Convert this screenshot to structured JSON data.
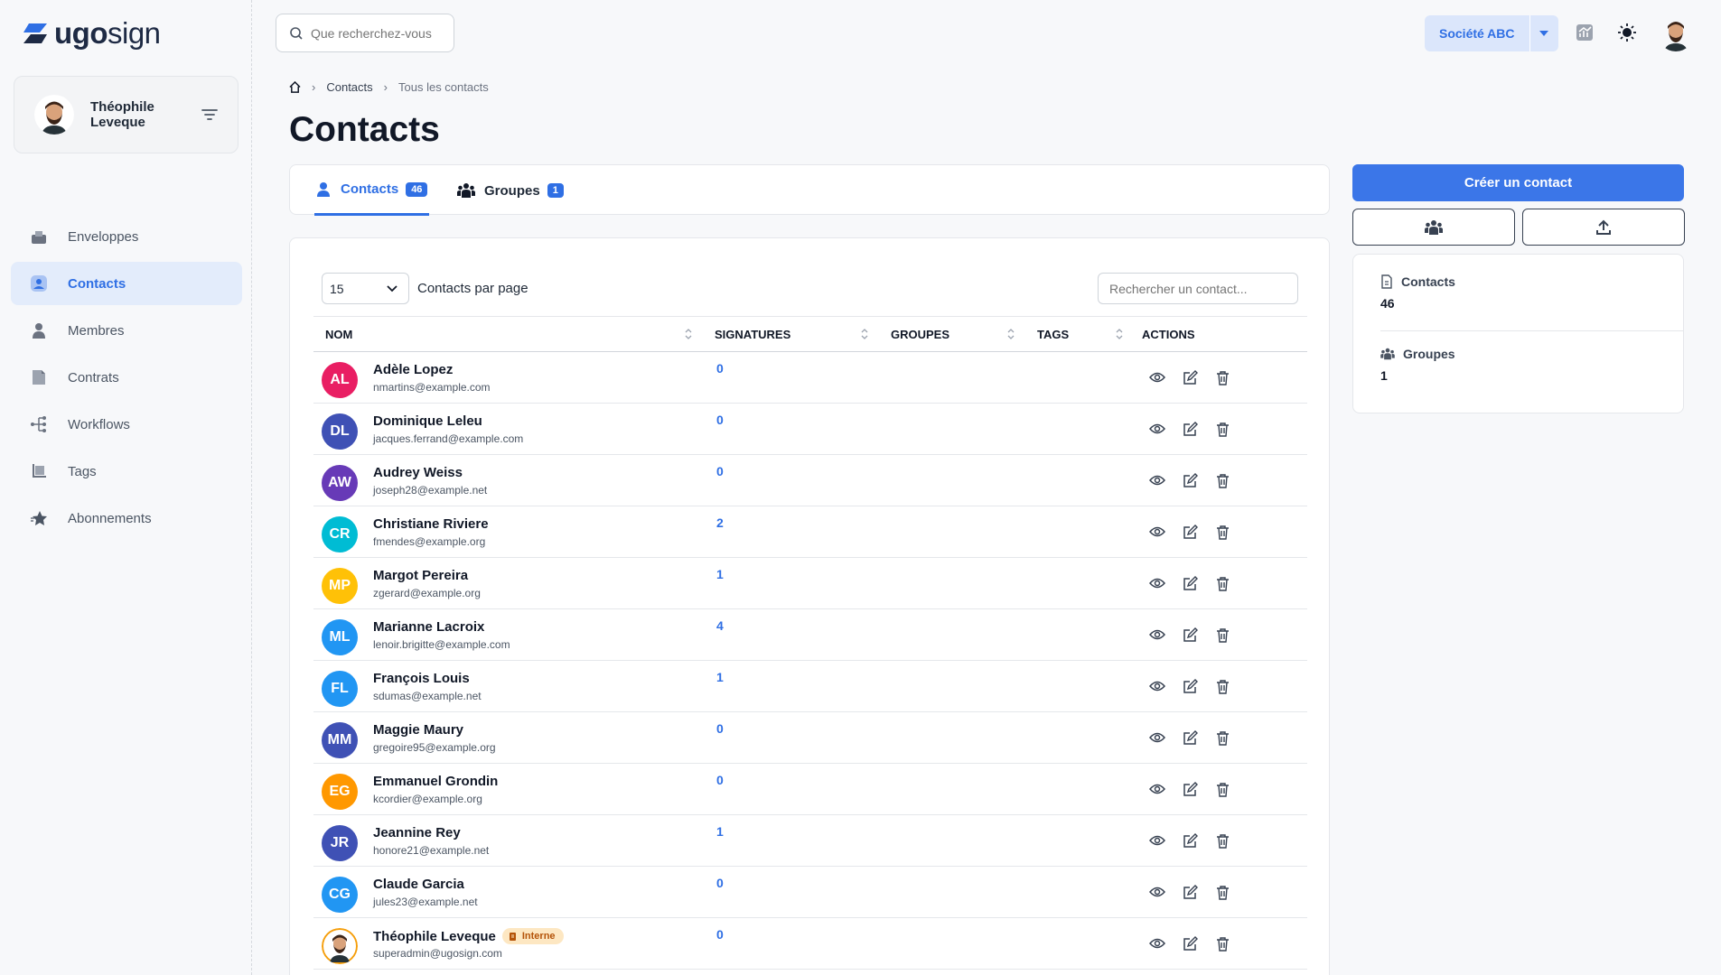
{
  "brand": {
    "name_bold": "ugo",
    "name_light": "sign"
  },
  "user": {
    "first_name": "Théophile",
    "last_name": "Leveque"
  },
  "search": {
    "placeholder": "Que recherchez-vous"
  },
  "company": {
    "name": "Société ABC"
  },
  "sidebar": {
    "items": [
      {
        "label": "Enveloppes",
        "icon": "envelope-tray-icon"
      },
      {
        "label": "Contacts",
        "icon": "contact-icon",
        "active": true
      },
      {
        "label": "Membres",
        "icon": "member-icon"
      },
      {
        "label": "Contrats",
        "icon": "contract-icon"
      },
      {
        "label": "Workflows",
        "icon": "workflow-icon"
      },
      {
        "label": "Tags",
        "icon": "tag-icon"
      },
      {
        "label": "Abonnements",
        "icon": "star-icon"
      }
    ]
  },
  "breadcrumb": {
    "level1": "Contacts",
    "level2": "Tous les contacts"
  },
  "page": {
    "title": "Contacts"
  },
  "tabs": [
    {
      "label": "Contacts",
      "count": "46"
    },
    {
      "label": "Groupes",
      "count": "1"
    }
  ],
  "table": {
    "per_page_value": "15",
    "per_page_label": "Contacts par page",
    "search_placeholder": "Rechercher un contact...",
    "columns": [
      "NOM",
      "SIGNATURES",
      "GROUPES",
      "TAGS",
      "ACTIONS"
    ],
    "rows": [
      {
        "initials": "AL",
        "name": "Adèle Lopez",
        "email": "nmartins@example.com",
        "signatures": "0",
        "color": "#e91e63"
      },
      {
        "initials": "DL",
        "name": "Dominique Leleu",
        "email": "jacques.ferrand@example.com",
        "signatures": "0",
        "color": "#3f51b5"
      },
      {
        "initials": "AW",
        "name": "Audrey Weiss",
        "email": "joseph28@example.net",
        "signatures": "0",
        "color": "#673ab7"
      },
      {
        "initials": "CR",
        "name": "Christiane Riviere",
        "email": "fmendes@example.org",
        "signatures": "2",
        "color": "#00bcd4"
      },
      {
        "initials": "MP",
        "name": "Margot Pereira",
        "email": "zgerard@example.org",
        "signatures": "1",
        "color": "#ffc107"
      },
      {
        "initials": "ML",
        "name": "Marianne Lacroix",
        "email": "lenoir.brigitte@example.com",
        "signatures": "4",
        "color": "#2196f3"
      },
      {
        "initials": "FL",
        "name": "François Louis",
        "email": "sdumas@example.net",
        "signatures": "1",
        "color": "#2196f3"
      },
      {
        "initials": "MM",
        "name": "Maggie Maury",
        "email": "gregoire95@example.org",
        "signatures": "0",
        "color": "#3f51b5"
      },
      {
        "initials": "EG",
        "name": "Emmanuel Grondin",
        "email": "kcordier@example.org",
        "signatures": "0",
        "color": "#ff9800"
      },
      {
        "initials": "JR",
        "name": "Jeannine Rey",
        "email": "honore21@example.net",
        "signatures": "1",
        "color": "#3f51b5"
      },
      {
        "initials": "CG",
        "name": "Claude Garcia",
        "email": "jules23@example.net",
        "signatures": "0",
        "color": "#2196f3"
      },
      {
        "initials": "",
        "name": "Théophile Leveque",
        "email": "superadmin@ugosign.com",
        "signatures": "0",
        "color": "#ffffff",
        "badge": "Interne"
      }
    ]
  },
  "actions": {
    "create_label": "Créer un contact"
  },
  "stats": {
    "contacts_label": "Contacts",
    "contacts_value": "46",
    "groups_label": "Groupes",
    "groups_value": "1"
  },
  "colors": {
    "accent": "#2f6fe4",
    "accent_light": "#e3ecfb"
  }
}
